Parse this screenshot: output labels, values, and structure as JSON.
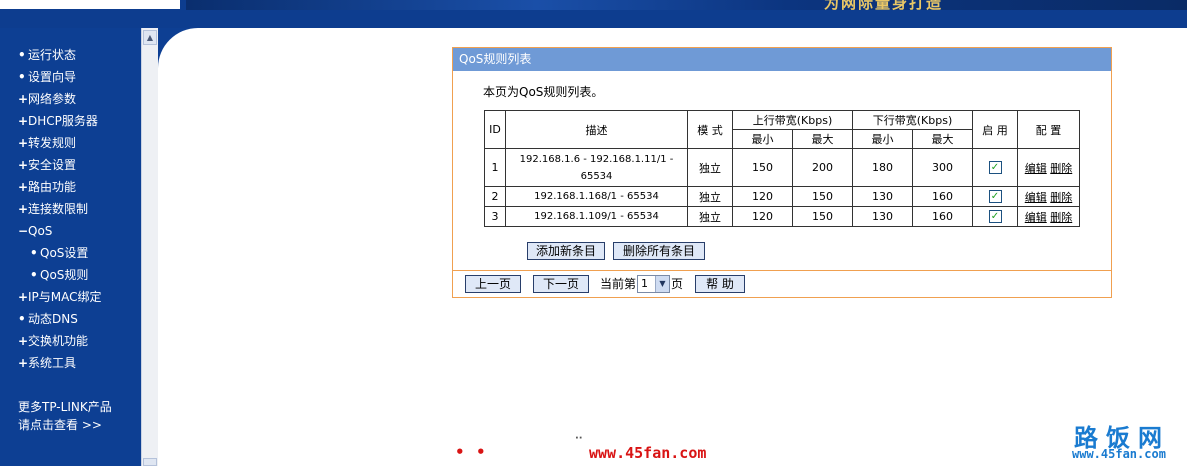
{
  "banner": {
    "slogan": "为网际量身打造"
  },
  "sidebar": {
    "items": [
      {
        "bullet": "•",
        "label": "运行状态"
      },
      {
        "bullet": "•",
        "label": "设置向导"
      },
      {
        "bullet": "+",
        "label": "网络参数"
      },
      {
        "bullet": "+",
        "label": "DHCP服务器"
      },
      {
        "bullet": "+",
        "label": "转发规则"
      },
      {
        "bullet": "+",
        "label": "安全设置"
      },
      {
        "bullet": "+",
        "label": "路由功能"
      },
      {
        "bullet": "+",
        "label": "连接数限制"
      },
      {
        "bullet": "−",
        "label": "QoS"
      },
      {
        "bullet": "•",
        "label": "QoS设置"
      },
      {
        "bullet": "•",
        "label": "QoS规则"
      },
      {
        "bullet": "+",
        "label": "IP与MAC绑定"
      },
      {
        "bullet": "•",
        "label": "动态DNS"
      },
      {
        "bullet": "+",
        "label": "交换机功能"
      },
      {
        "bullet": "+",
        "label": "系统工具"
      }
    ],
    "footer_line1": "更多TP-LINK产品",
    "footer_line2": "请点击查看 >>"
  },
  "panel": {
    "title": "QoS规则列表",
    "description": "本页为QoS规则列表。",
    "table": {
      "headers": {
        "id": "ID",
        "desc": "描述",
        "mode": "模 式",
        "up": "上行带宽(Kbps)",
        "down": "下行带宽(Kbps)",
        "enable": "启 用",
        "config": "配 置",
        "min": "最小",
        "max": "最大"
      },
      "rows": [
        {
          "id": "1",
          "desc": "192.168.1.6 - 192.168.1.11/1 - 65534",
          "mode": "独立",
          "up_min": "150",
          "up_max": "200",
          "down_min": "180",
          "down_max": "300",
          "enabled": true,
          "edit": "编辑",
          "delete": "删除"
        },
        {
          "id": "2",
          "desc": "192.168.1.168/1 - 65534",
          "mode": "独立",
          "up_min": "120",
          "up_max": "150",
          "down_min": "130",
          "down_max": "160",
          "enabled": true,
          "edit": "编辑",
          "delete": "删除"
        },
        {
          "id": "3",
          "desc": "192.168.1.109/1 - 65534",
          "mode": "独立",
          "up_min": "120",
          "up_max": "150",
          "down_min": "130",
          "down_max": "160",
          "enabled": true,
          "edit": "编辑",
          "delete": "删除"
        }
      ]
    },
    "add_button": "添加新条目",
    "delete_all_button": "删除所有条目",
    "prev_button": "上一页",
    "next_button": "下一页",
    "current_page_label": "当前第",
    "current_page_value": "1",
    "page_suffix": "页",
    "help_button": "帮 助"
  },
  "footer": {
    "url": "www.45fan.com",
    "watermark_title": "路饭网",
    "watermark_url": "www.45fan.com"
  }
}
